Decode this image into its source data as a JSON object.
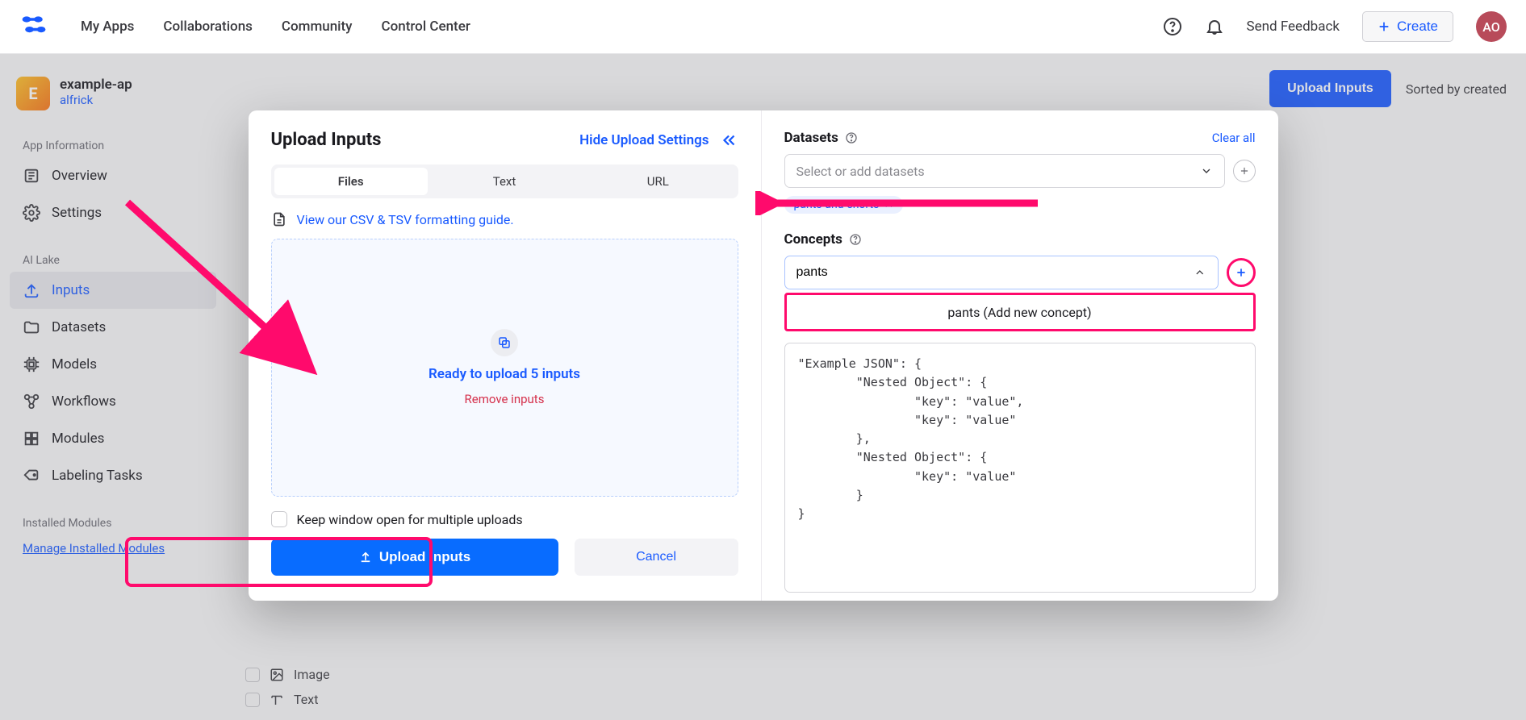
{
  "nav": {
    "links": [
      "My Apps",
      "Collaborations",
      "Community",
      "Control Center"
    ],
    "feedback": "Send Feedback",
    "create": "Create",
    "avatar": "AO"
  },
  "app": {
    "icon_letter": "E",
    "name": "example-ap",
    "user": "alfrick"
  },
  "sidebar": {
    "app_info_title": "App Information",
    "app_info_items": [
      "Overview",
      "Settings"
    ],
    "ai_lake_title": "AI Lake",
    "ai_lake_items": [
      "Inputs",
      "Datasets",
      "Models",
      "Workflows",
      "Modules",
      "Labeling Tasks"
    ],
    "installed_title": "Installed Modules",
    "installed_link": "Manage Installed Modules"
  },
  "content": {
    "upload_btn": "Upload Inputs",
    "sorted_by": "Sorted by created"
  },
  "filters": {
    "image": "Image",
    "text": "Text"
  },
  "modal": {
    "title": "Upload Inputs",
    "hide": "Hide Upload Settings",
    "tabs": [
      "Files",
      "Text",
      "URL"
    ],
    "csv_link": "View our CSV & TSV formatting guide.",
    "ready": "Ready to upload 5 inputs",
    "remove": "Remove inputs",
    "keep_open": "Keep window open for multiple uploads",
    "upload_btn": "Upload inputs",
    "cancel": "Cancel"
  },
  "right": {
    "datasets_title": "Datasets",
    "clear_all": "Clear all",
    "datasets_placeholder": "Select or add datasets",
    "dataset_chip": "pants-and-shorts",
    "concepts_title": "Concepts",
    "concept_input": "pants",
    "dropdown_option": "pants (Add new concept)",
    "json_example": "\"Example JSON\": {\n        \"Nested Object\": {\n                \"key\": \"value\",\n                \"key\": \"value\"\n        },\n        \"Nested Object\": {\n                \"key\": \"value\"\n        }\n}"
  }
}
